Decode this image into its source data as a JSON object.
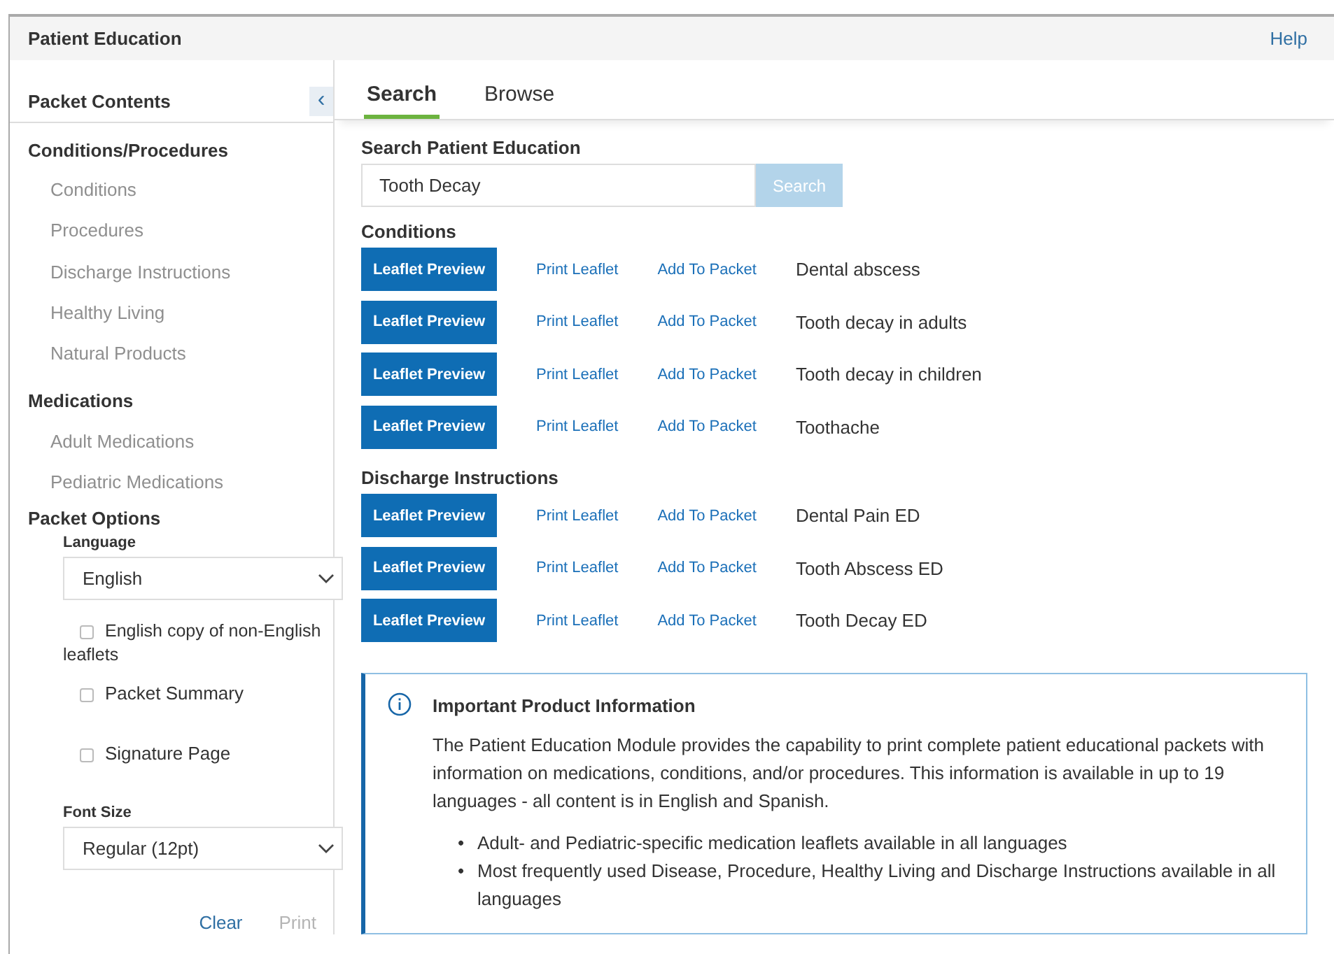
{
  "window": {
    "title": "Patient Education",
    "help": "Help"
  },
  "sidebar": {
    "title": "Packet Contents",
    "collapse_icon": "‹",
    "sections": [
      {
        "heading": "Conditions/Procedures",
        "items": [
          "Conditions",
          "Procedures",
          "Discharge Instructions",
          "Healthy Living",
          "Natural Products"
        ]
      },
      {
        "heading": "Medications",
        "items": [
          "Adult Medications",
          "Pediatric Medications"
        ]
      }
    ],
    "options": {
      "heading": "Packet Options",
      "language": {
        "label": "Language",
        "value": "English"
      },
      "checkboxes": [
        {
          "label": "English copy of non-English leaflets",
          "checked": false
        },
        {
          "label": "Packet Summary",
          "checked": false
        },
        {
          "label": "Signature Page",
          "checked": false
        }
      ],
      "font_size": {
        "label": "Font Size",
        "value": "Regular (12pt)"
      },
      "buttons": [
        {
          "label": "Clear",
          "disabled": false
        },
        {
          "label": "Print",
          "disabled": true
        }
      ]
    }
  },
  "tabs": [
    {
      "label": "Search",
      "selected": true
    },
    {
      "label": "Browse",
      "selected": false
    }
  ],
  "search": {
    "label": "Search Patient Education",
    "value": "Tooth Decay",
    "button": {
      "label": "Search",
      "disabled": true
    }
  },
  "groups": [
    {
      "heading": "Conditions",
      "results": [
        {
          "preview": "Leaflet Preview",
          "print": "Print Leaflet",
          "add": "Add To Packet",
          "name": "Dental abscess"
        },
        {
          "preview": "Leaflet Preview",
          "print": "Print Leaflet",
          "add": "Add To Packet",
          "name": "Tooth decay in adults"
        },
        {
          "preview": "Leaflet Preview",
          "print": "Print Leaflet",
          "add": "Add To Packet",
          "name": "Tooth decay in children"
        },
        {
          "preview": "Leaflet Preview",
          "print": "Print Leaflet",
          "add": "Add To Packet",
          "name": "Toothache"
        }
      ]
    },
    {
      "heading": "Discharge Instructions",
      "results": [
        {
          "preview": "Leaflet Preview",
          "print": "Print Leaflet",
          "add": "Add To Packet",
          "name": "Dental Pain ED"
        },
        {
          "preview": "Leaflet Preview",
          "print": "Print Leaflet",
          "add": "Add To Packet",
          "name": "Tooth Abscess ED"
        },
        {
          "preview": "Leaflet Preview",
          "print": "Print Leaflet",
          "add": "Add To Packet",
          "name": "Tooth Decay ED"
        }
      ]
    }
  ],
  "info": {
    "title": "Important Product Information",
    "paragraph": "The Patient Education Module provides the capability to print complete patient educational packets with information on medications, conditions, and/or procedures. This information is available in up to 19 languages - all content is in English and Spanish.",
    "bullet_marker": "•",
    "bullets": [
      "Adult- and Pediatric-specific medication leaflets available in all languages",
      "Most frequently used Disease, Procedure, Healthy Living and Discharge Instructions available in all languages"
    ]
  }
}
